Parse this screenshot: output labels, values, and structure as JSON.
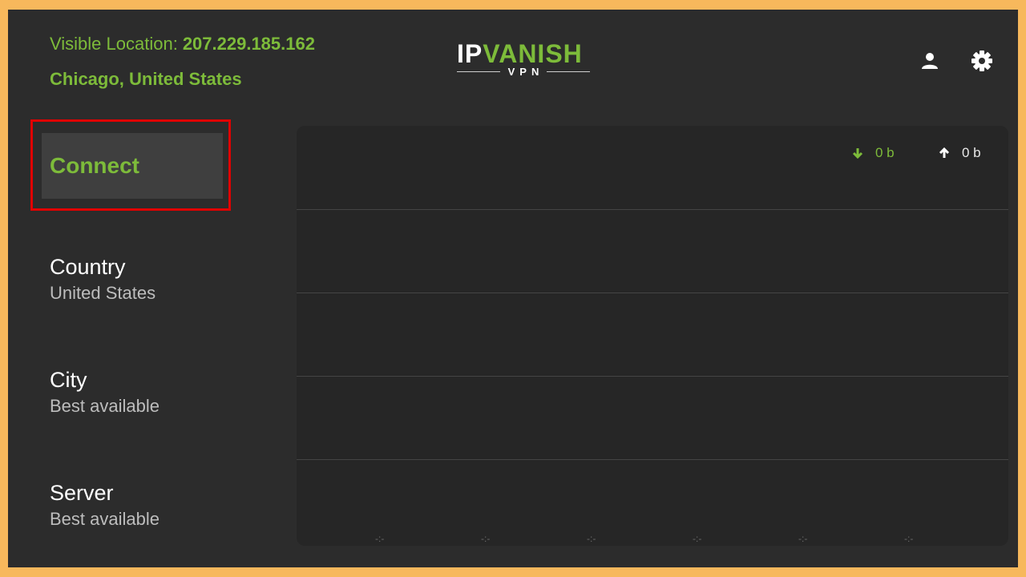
{
  "header": {
    "visible_location_label": "Visible Location:",
    "ip_address": "207.229.185.162",
    "location": "Chicago, United States",
    "logo": {
      "ip": "IP",
      "vanish": "VANISH",
      "sub": "VPN"
    },
    "icons": [
      "account-icon",
      "settings-icon"
    ]
  },
  "sidebar": {
    "connect_label": "Connect",
    "items": [
      {
        "title": "Country",
        "value": "United States"
      },
      {
        "title": "City",
        "value": "Best available"
      },
      {
        "title": "Server",
        "value": "Best available"
      }
    ]
  },
  "graph": {
    "download": "0 b",
    "upload": "0 b",
    "time_ticks": [
      "-:-",
      "-:-",
      "-:-",
      "-:-",
      "-:-",
      "-:-"
    ]
  },
  "colors": {
    "accent": "#7dbb3a",
    "background": "#2c2c2c",
    "frame": "#f7b85c",
    "highlight": "#e00000"
  }
}
